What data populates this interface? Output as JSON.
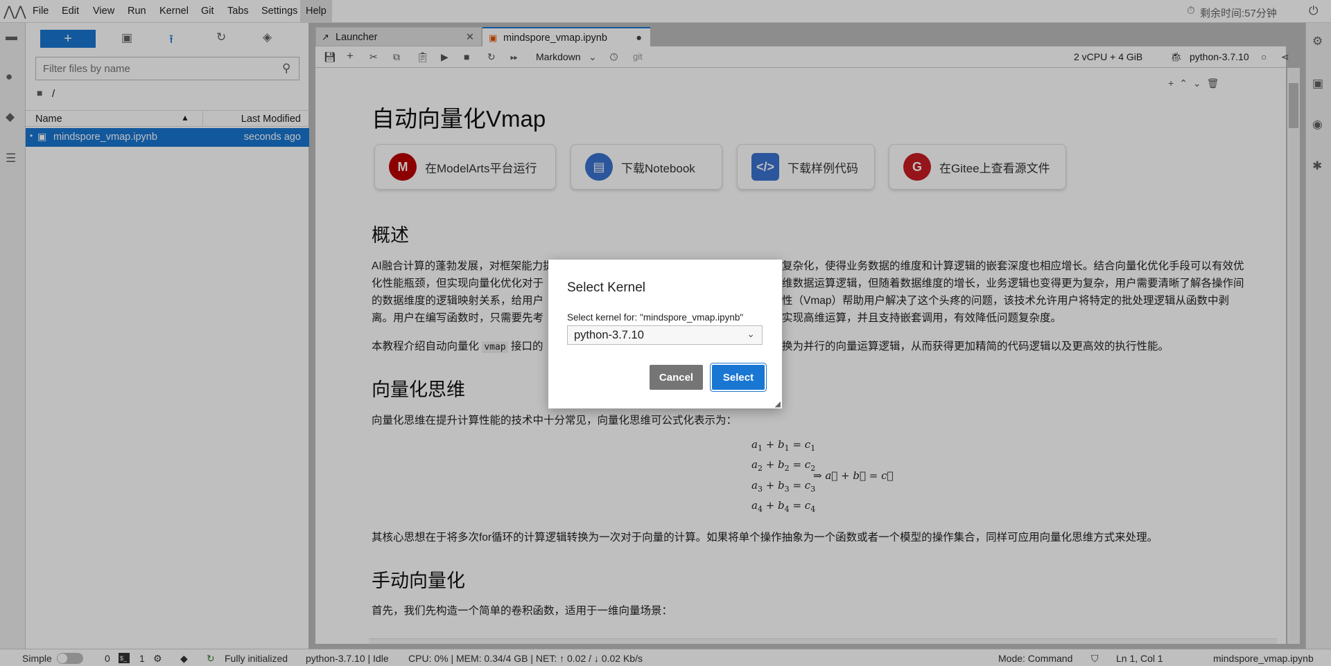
{
  "menubar": {
    "items": [
      "File",
      "Edit",
      "View",
      "Run",
      "Kernel",
      "Git",
      "Tabs",
      "Settings",
      "Help"
    ],
    "timer": "剩余时间:57分钟"
  },
  "filebrowser": {
    "new_label": "+",
    "filter_placeholder": "Filter files by name",
    "path": "/",
    "col_name": "Name",
    "col_modified": "Last Modified",
    "files": [
      {
        "name": "mindspore_vmap.ipynb",
        "modified": "seconds ago"
      }
    ]
  },
  "tabs": [
    {
      "label": "Launcher"
    },
    {
      "label": "mindspore_vmap.ipynb"
    }
  ],
  "toolbar": {
    "cell_type": "Markdown",
    "git": "git",
    "resources": "2 vCPU + 4 GiB",
    "kernel": "python-3.7.10"
  },
  "notebook": {
    "title": "自动向量化Vmap",
    "buttons": [
      "在ModelArts平台运行",
      "下载Notebook",
      "下载样例代码",
      "在Gitee上查看源文件"
    ],
    "h_overview": "概述",
    "overview_lines": [
      {
        "left": "AI融合计算的蓬勃发展，对框架能力提",
        "right": "复杂化，使得业务数据的维度和计算逻辑的嵌套深度也相应增长。结合向量化优化手段可以有效优"
      },
      {
        "left": "化性能瓶颈，但实现向量化优化对于",
        "right": "维数据运算逻辑，但随着数据维度的增长，业务逻辑也变得更为复杂，用户需要清晰了解各操作间"
      },
      {
        "left": "的数据维度的逻辑映射关系，给用户",
        "right": "性（Vmap）帮助用户解决了这个头疼的问题，该技术允许用户将特定的批处理逻辑从函数中剥"
      },
      {
        "left": "离。用户在编写函数时，只需要先考",
        "right": "实现高维运算，并且支持嵌套调用，有效降低问题复杂度。"
      }
    ],
    "intro": {
      "left": "本教程介绍自动向量化",
      "code": "vmap",
      "left2": "接口的",
      "right": "换为并行的向量运算逻辑，从而获得更加精简的代码逻辑以及更高效的执行性能。"
    },
    "h_thinking": "向量化思维",
    "thinking_p": "向量化思维在提升计算性能的技术中十分常见，向量化思维可公式化表示为：",
    "equations": [
      "a1 + b1 = c1",
      "a2 + b2 = c2",
      "a3 + b3 = c3",
      "a4 + b4 = c4"
    ],
    "vector_eq": "⇒ a⃗ + b⃗ = c⃗",
    "core_p": "其核心思想在于将多次for循环的计算逻辑转换为一次对于向量的计算。如果将单个操作抽象为一个函数或者一个模型的操作集合，同样可应用向量化思维方式来处理。",
    "h_manual": "手动向量化",
    "manual_p": "首先，我们先构造一个简单的卷积函数，适用于一维向量场景："
  },
  "statusbar": {
    "mode_label": "Simple",
    "terminals": "0",
    "kernels": "1",
    "git_status": "Fully initialized",
    "kernel_status": "python-3.7.10 | Idle",
    "metrics": "CPU: 0% | MEM: 0.34/4 GB | NET: ↑ 0.02 / ↓ 0.02 Kb/s",
    "mode": "Mode: Command",
    "cursor": "Ln 1, Col 1",
    "filename": "mindspore_vmap.ipynb"
  },
  "dialog": {
    "title": "Select Kernel",
    "label": "Select kernel for: \"mindspore_vmap.ipynb\"",
    "selected": "python-3.7.10",
    "cancel": "Cancel",
    "select": "Select"
  },
  "colors": {
    "accent": "#1976d2",
    "cancel": "#757575"
  }
}
